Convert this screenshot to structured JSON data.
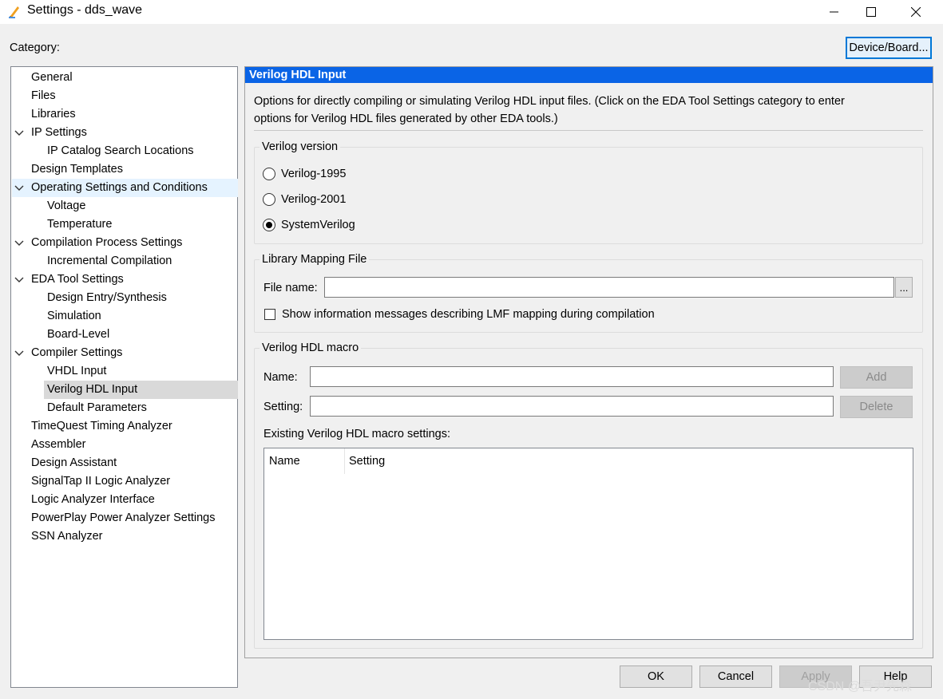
{
  "window": {
    "title": "Settings - dds_wave",
    "icon": "pencil-icon",
    "controls": [
      "minimize-icon",
      "maximize-icon",
      "close-icon"
    ]
  },
  "category_label": "Category:",
  "device_board_button": "Device/Board...",
  "tree": [
    {
      "label": "General",
      "level": 0
    },
    {
      "label": "Files",
      "level": 0
    },
    {
      "label": "Libraries",
      "level": 0
    },
    {
      "label": "IP Settings",
      "level": 0,
      "expanded": true
    },
    {
      "label": "IP Catalog Search Locations",
      "level": 1
    },
    {
      "label": "Design Templates",
      "level": 0
    },
    {
      "label": "Operating Settings and Conditions",
      "level": 0,
      "expanded": true,
      "hover": true
    },
    {
      "label": "Voltage",
      "level": 1
    },
    {
      "label": "Temperature",
      "level": 1
    },
    {
      "label": "Compilation Process Settings",
      "level": 0,
      "expanded": true
    },
    {
      "label": "Incremental Compilation",
      "level": 1
    },
    {
      "label": "EDA Tool Settings",
      "level": 0,
      "expanded": true
    },
    {
      "label": "Design Entry/Synthesis",
      "level": 1
    },
    {
      "label": "Simulation",
      "level": 1
    },
    {
      "label": "Board-Level",
      "level": 1
    },
    {
      "label": "Compiler Settings",
      "level": 0,
      "expanded": true
    },
    {
      "label": "VHDL Input",
      "level": 1
    },
    {
      "label": "Verilog HDL Input",
      "level": 1,
      "selected": true
    },
    {
      "label": "Default Parameters",
      "level": 1
    },
    {
      "label": "TimeQuest Timing Analyzer",
      "level": 0
    },
    {
      "label": "Assembler",
      "level": 0
    },
    {
      "label": "Design Assistant",
      "level": 0
    },
    {
      "label": "SignalTap II Logic Analyzer",
      "level": 0
    },
    {
      "label": "Logic Analyzer Interface",
      "level": 0
    },
    {
      "label": "PowerPlay Power Analyzer Settings",
      "level": 0
    },
    {
      "label": "SSN Analyzer",
      "level": 0
    }
  ],
  "panel": {
    "header": "Verilog HDL Input",
    "description_line1": "Options for directly compiling or simulating Verilog HDL input files.  (Click on the EDA Tool Settings category to enter",
    "description_line2": "options for Verilog HDL files generated by other EDA tools.)",
    "verilog_version": {
      "title": "Verilog version",
      "options": [
        {
          "label": "Verilog-1995",
          "selected": false
        },
        {
          "label": "Verilog-2001",
          "selected": false
        },
        {
          "label": "SystemVerilog",
          "selected": true
        }
      ]
    },
    "library_mapping": {
      "title": "Library Mapping File",
      "file_label": "File name:",
      "file_value": "",
      "browse_label": "...",
      "checkbox_label": "Show information messages describing LMF mapping during compilation",
      "checkbox_checked": false
    },
    "macro": {
      "title": "Verilog HDL macro",
      "name_label": "Name:",
      "name_value": "",
      "setting_label": "Setting:",
      "setting_value": "",
      "add_label": "Add",
      "delete_label": "Delete",
      "existing_label": "Existing Verilog HDL macro settings:",
      "columns": [
        "Name",
        "Setting"
      ],
      "rows": []
    }
  },
  "buttons": {
    "ok": "OK",
    "cancel": "Cancel",
    "apply": "Apply",
    "help": "Help"
  },
  "watermark": "CSDN @吾尹先森"
}
